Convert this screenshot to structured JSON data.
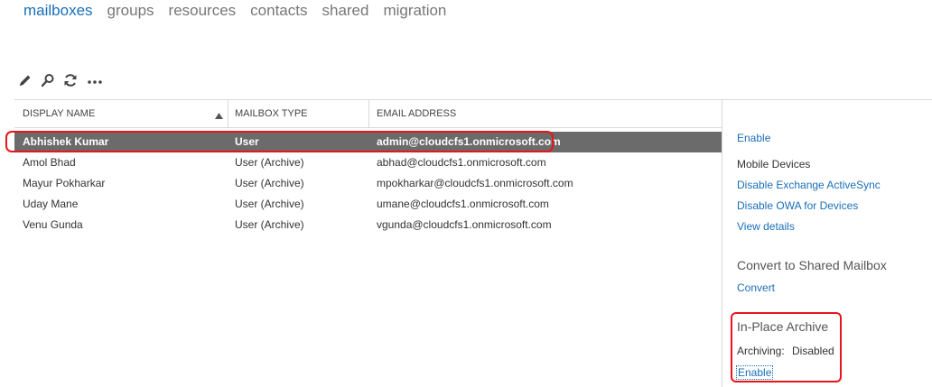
{
  "nav": {
    "tabs": [
      {
        "label": "mailboxes"
      },
      {
        "label": "groups"
      },
      {
        "label": "resources"
      },
      {
        "label": "contacts"
      },
      {
        "label": "shared"
      },
      {
        "label": "migration"
      }
    ],
    "active_tab": "mailboxes"
  },
  "toolbar": {
    "icons": [
      "edit-icon",
      "search-icon",
      "refresh-icon",
      "more-icon"
    ],
    "more_label": "..."
  },
  "table": {
    "columns": [
      "DISPLAY NAME",
      "MAILBOX TYPE",
      "EMAIL ADDRESS"
    ],
    "sort_indicator": "▲",
    "rows": [
      {
        "name": "Abhishek Kumar",
        "type": "User",
        "email": "admin@cloudcfs1.onmicrosoft.com",
        "selected": true
      },
      {
        "name": "Amol Bhad",
        "type": "User (Archive)",
        "email": "abhad@cloudcfs1.onmicrosoft.com",
        "selected": false
      },
      {
        "name": "Mayur Pokharkar",
        "type": "User (Archive)",
        "email": "mpokharkar@cloudcfs1.onmicrosoft.com",
        "selected": false
      },
      {
        "name": "Uday Mane",
        "type": "User (Archive)",
        "email": "umane@cloudcfs1.onmicrosoft.com",
        "selected": false
      },
      {
        "name": "Venu Gunda",
        "type": "User (Archive)",
        "email": "vgunda@cloudcfs1.onmicrosoft.com",
        "selected": false
      }
    ]
  },
  "details": {
    "enable_top": "Enable",
    "mobile_devices_label": "Mobile Devices",
    "disable_activesync": "Disable Exchange ActiveSync",
    "disable_owa": "Disable OWA for Devices",
    "view_details": "View details",
    "convert_section": "Convert to Shared Mailbox",
    "convert_link": "Convert",
    "archive_section": "In-Place Archive",
    "archiving_label": "Archiving:",
    "archiving_status": "Disabled",
    "archive_enable": "Enable"
  },
  "colors": {
    "accent": "#1a6fb8",
    "selected_row": "#6b6b6b",
    "highlight": "#e8151b"
  }
}
